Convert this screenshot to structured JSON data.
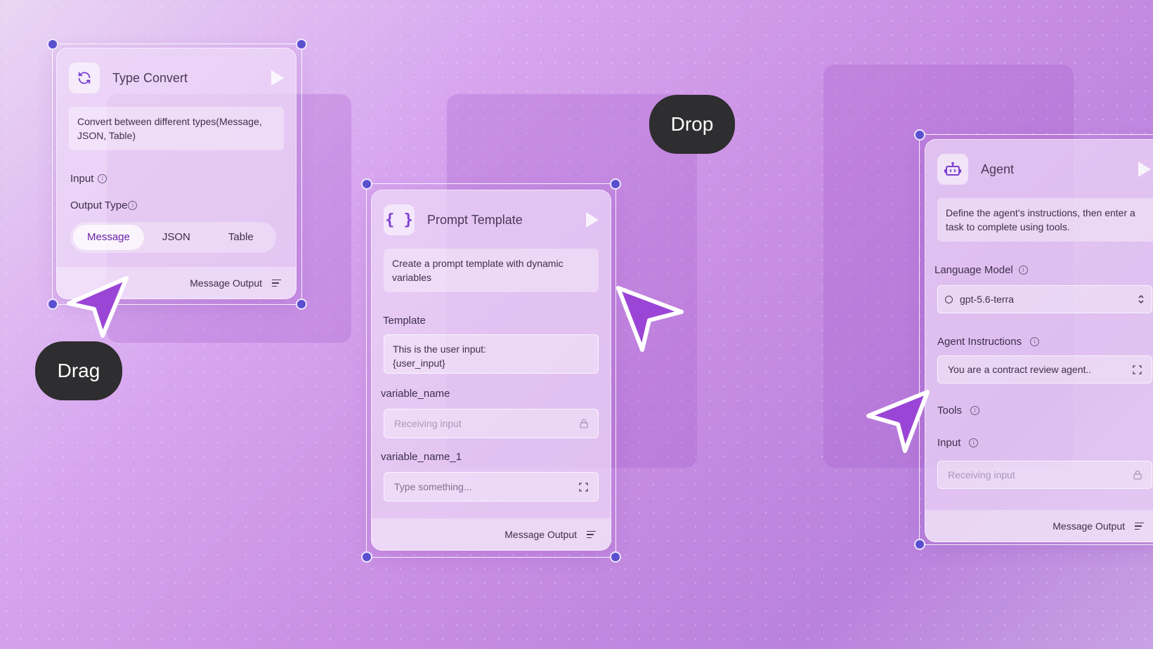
{
  "type_convert": {
    "title": "Type Convert",
    "description": "Convert between different types(Message, JSON, Table)",
    "input_label": "Input",
    "output_type_label": "Output Type",
    "options": [
      "Message",
      "JSON",
      "Table"
    ],
    "selected": "Message",
    "footer": "Message Output"
  },
  "prompt_template": {
    "title": "Prompt Template",
    "description": "Create a prompt template with dynamic variables",
    "template_label": "Template",
    "template_value_line1": "This is the user input:",
    "template_value_line2": "{user_input}",
    "var1_label": "variable_name",
    "var1_placeholder": "Receiving input",
    "var2_label": "variable_name_1",
    "var2_placeholder": "Type something...",
    "footer": "Message Output"
  },
  "agent": {
    "title": "Agent",
    "description": "Define the agent’s instructions, then enter a task to complete using tools.",
    "language_model_label": "Language Model",
    "model_value": "gpt-5.6-terra",
    "instructions_label": "Agent Instructions",
    "instructions_value": "You are a contract review agent..",
    "tools_label": "Tools",
    "input_label": "Input",
    "input_placeholder": "Receiving input",
    "footer": "Message Output"
  },
  "pills": {
    "drag": "Drag",
    "drop": "Drop"
  },
  "colors": {
    "handle": "#5b4fd0",
    "accent": "#7b3fd0",
    "pill_bg": "#2e2d2f"
  }
}
